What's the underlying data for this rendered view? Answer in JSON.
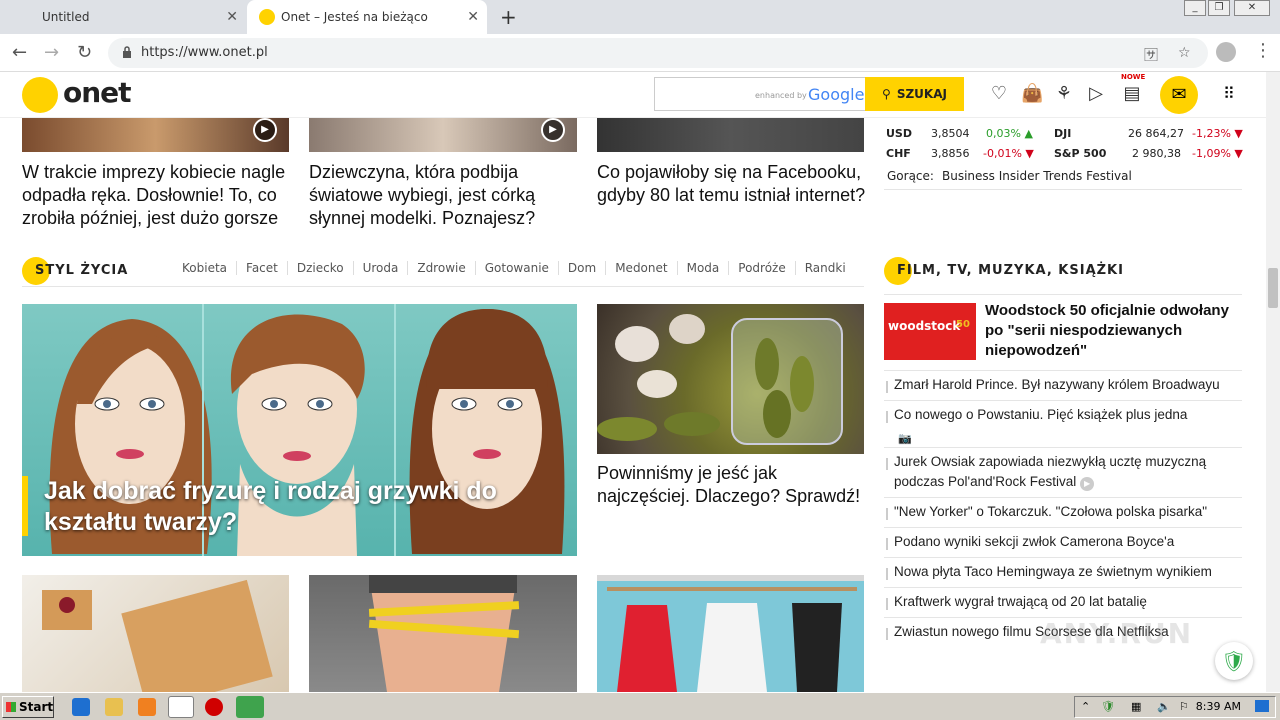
{
  "browser": {
    "tabs": [
      {
        "title": "Untitled"
      },
      {
        "title": "Onet – Jesteś na bieżąco"
      }
    ],
    "url": "https://www.onet.pl"
  },
  "header": {
    "logo": "onet",
    "search_enhanced": "enhanced by",
    "search_google": "Google",
    "search_button": "SZUKAJ",
    "nowe_badge": "NOWE"
  },
  "top_articles": [
    {
      "title": "W trakcie imprezy kobiecie nagle odpadła ręka. Dosłownie! To, co zrobiła później, jest dużo gorsze"
    },
    {
      "title": "Dziewczyna, która podbija światowe wybiegi, jest córką słynnej modelki. Poznajesz?"
    },
    {
      "title": "Co pojawiłoby się na Facebooku, gdyby 80 lat temu istniał internet?"
    }
  ],
  "finance": {
    "rows": [
      {
        "name": "USD",
        "value": "3,8504",
        "change": "0,03%",
        "dir": "up",
        "name2": "DJI",
        "value2": "26 864,27",
        "change2": "-1,23%",
        "dir2": "down"
      },
      {
        "name": "CHF",
        "value": "3,8856",
        "change": "-0,01%",
        "dir": "down",
        "name2": "S&P 500",
        "value2": "2 980,38",
        "change2": "-1,09%",
        "dir2": "down"
      }
    ],
    "hot_label": "Gorące:",
    "hot_text": "Business Insider Trends Festival"
  },
  "styl_zycia": {
    "title": "STYL ŻYCIA",
    "subnav": [
      "Kobieta",
      "Facet",
      "Dziecko",
      "Uroda",
      "Zdrowie",
      "Gotowanie",
      "Dom",
      "Medonet",
      "Moda",
      "Podróże",
      "Randki"
    ],
    "big_article": "Jak dobrać fryzurę i rodzaj grzywki do kształtu twarzy?",
    "side_article": "Powinniśmy je jeść jak najczęściej. Dlaczego? Sprawdź!"
  },
  "film": {
    "title": "FILM, TV, MUZYKA, KSIĄŻKI",
    "lead": "Woodstock 50 oficjalnie odwołany po \"serii niespodziewanych niepowodzeń\"",
    "lead_img_text": "woodstock",
    "lead_img_num": "50",
    "items": [
      "Zmarł Harold Prince. Był nazywany królem Broadwayu",
      "Co nowego o Powstaniu. Pięć książek plus jedna",
      "Jurek Owsiak zapowiada niezwykłą ucztę muzyczną podczas Pol'and'Rock Festival",
      "\"New Yorker\" o Tokarczuk. \"Czołowa polska pisarka\"",
      "Podano wyniki sekcji zwłok Camerona Boyce'a",
      "Nowa płyta Taco Hemingwaya ze świetnym wynikiem",
      "Kraftwerk wygrał trwającą od 20 lat batalię",
      "Zwiastun nowego filmu Scorsese dla Netfliksa"
    ]
  },
  "taskbar": {
    "start": "Start",
    "clock": "8:39 AM"
  },
  "watermark": "ANY.RUN",
  "colors": {
    "brand": "#ffd200",
    "up": "#2a9d2a",
    "down": "#d0021b"
  }
}
